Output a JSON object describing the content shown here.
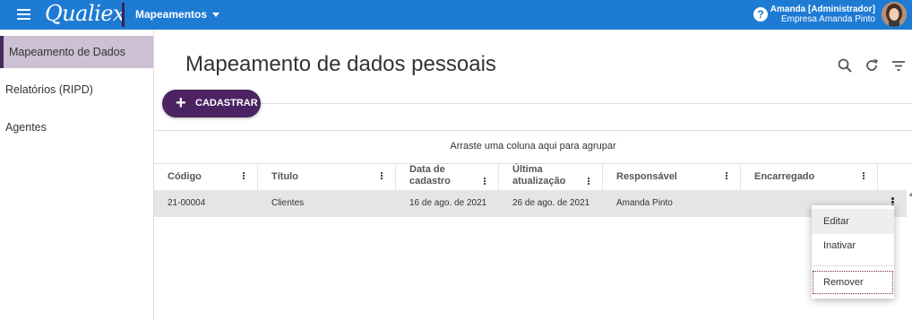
{
  "header": {
    "logo_text": "Qualiex",
    "module_label": "Mapeamentos",
    "help_icon": "?",
    "user_name": "Amanda [Administrador]",
    "user_company": "Empresa Amanda Pinto",
    "brand_color": "#1e7bd4",
    "accent_color": "#4b2362"
  },
  "sidebar": {
    "items": [
      {
        "label": "Mapeamento de Dados",
        "active": true
      },
      {
        "label": "Relatórios (RIPD)",
        "active": false
      },
      {
        "label": "Agentes",
        "active": false
      }
    ]
  },
  "main": {
    "title": "Mapeamento de dados pessoais",
    "toolbar_icons": [
      "search-icon",
      "refresh-icon",
      "filter-icon"
    ],
    "add_button_label": "CADASTRAR"
  },
  "grid": {
    "group_panel_text": "Arraste uma coluna aqui para agrupar",
    "columns": [
      {
        "label": "Código"
      },
      {
        "label": "Título"
      },
      {
        "label": "Data de",
        "label2": "cadastro"
      },
      {
        "label": "Última",
        "label2": "atualização"
      },
      {
        "label": "Responsável"
      },
      {
        "label": "Encarregado"
      }
    ],
    "rows": [
      {
        "codigo": "21-00004",
        "titulo": "Clientes",
        "data_cadastro": "16 de ago. de 2021",
        "ultima_atualizacao": "26 de ago. de 2021",
        "responsavel": "Amanda Pinto",
        "encarregado": ""
      }
    ]
  },
  "context_menu": {
    "items": [
      "Editar",
      "Inativar",
      "Remover"
    ]
  }
}
